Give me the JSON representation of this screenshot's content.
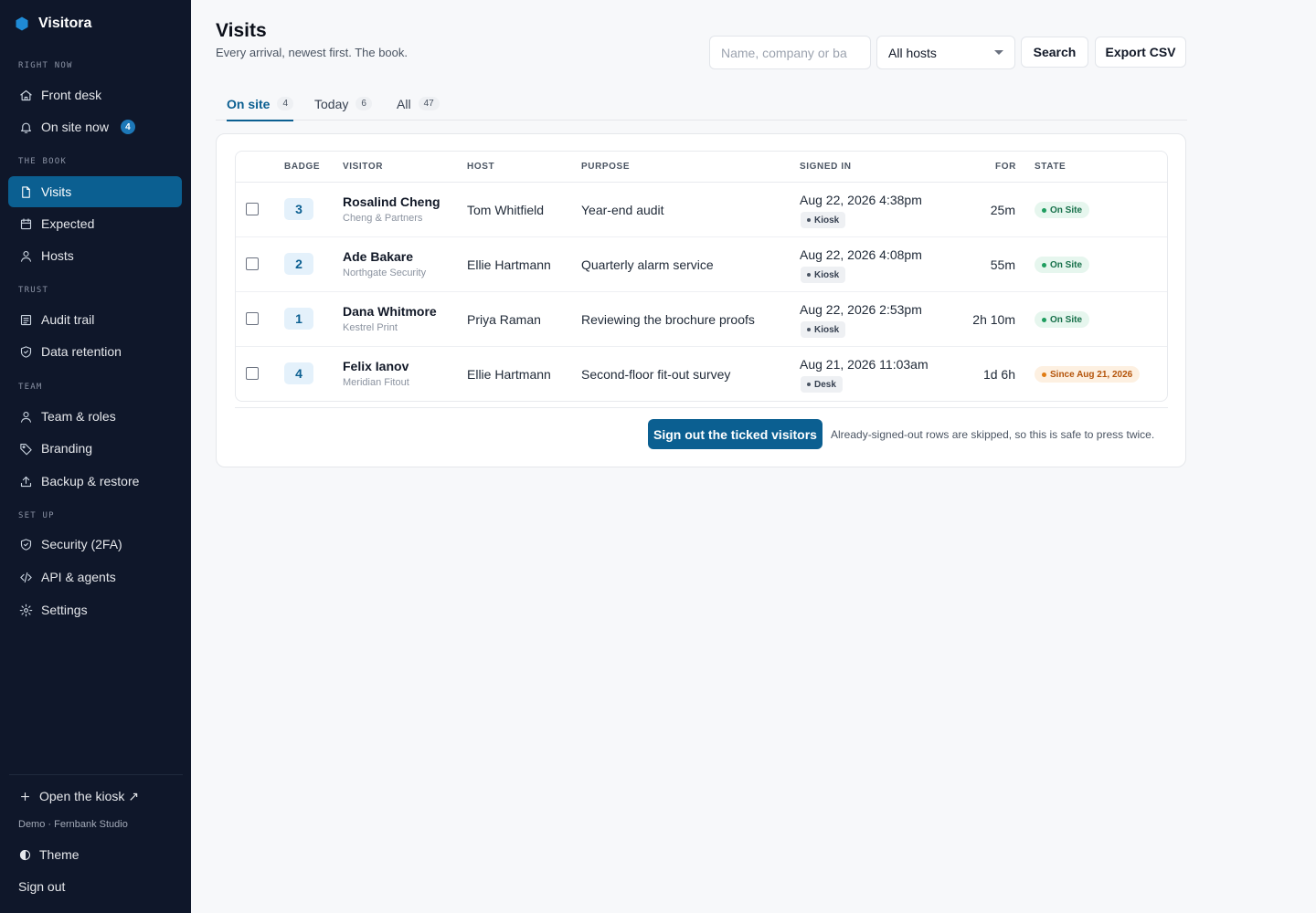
{
  "app": {
    "name": "Visitora"
  },
  "sidebar": {
    "sections": {
      "right_now": "RIGHT NOW",
      "the_book": "THE BOOK",
      "trust": "TRUST",
      "team": "TEAM",
      "set_up": "SET UP"
    },
    "items": {
      "front_desk": "Front desk",
      "on_site_now": "On site now",
      "on_site_count": "4",
      "visits": "Visits",
      "expected": "Expected",
      "hosts": "Hosts",
      "audit_trail": "Audit trail",
      "data_retention": "Data retention",
      "team_roles": "Team & roles",
      "branding": "Branding",
      "backup_restore": "Backup & restore",
      "security": "Security (2FA)",
      "api_agents": "API & agents",
      "settings": "Settings"
    },
    "footer": {
      "open_kiosk": "Open the kiosk ↗",
      "workspace": "Demo · Fernbank Studio",
      "theme": "Theme",
      "sign_out": "Sign out"
    }
  },
  "header": {
    "title": "Visits",
    "subtitle": "Every arrival, newest first. The book.",
    "search_placeholder": "Name, company or ba",
    "host_filter": "All hosts",
    "search_label": "Search",
    "export_label": "Export CSV"
  },
  "tabs": [
    {
      "label": "On site",
      "count": "4"
    },
    {
      "label": "Today",
      "count": "6"
    },
    {
      "label": "All",
      "count": "47"
    }
  ],
  "table": {
    "columns": {
      "badge": "BADGE",
      "visitor": "VISITOR",
      "host": "HOST",
      "purpose": "PURPOSE",
      "signed_in": "SIGNED IN",
      "for": "FOR",
      "state": "STATE"
    },
    "rows": [
      {
        "badge": "3",
        "name": "Rosalind Cheng",
        "company": "Cheng & Partners",
        "host": "Tom Whitfield",
        "purpose": "Year-end audit",
        "signed_in": "Aug 22, 2026 4:38pm",
        "source": "Kiosk",
        "duration": "25m",
        "state": "On Site"
      },
      {
        "badge": "2",
        "name": "Ade Bakare",
        "company": "Northgate Security",
        "host": "Ellie Hartmann",
        "purpose": "Quarterly alarm service",
        "signed_in": "Aug 22, 2026 4:08pm",
        "source": "Kiosk",
        "duration": "55m",
        "state": "On Site"
      },
      {
        "badge": "1",
        "name": "Dana Whitmore",
        "company": "Kestrel Print",
        "host": "Priya Raman",
        "purpose": "Reviewing the brochure proofs",
        "signed_in": "Aug 22, 2026 2:53pm",
        "source": "Kiosk",
        "duration": "2h 10m",
        "state": "On Site"
      },
      {
        "badge": "4",
        "name": "Felix Ianov",
        "company": "Meridian Fitout",
        "host": "Ellie Hartmann",
        "purpose": "Second-floor fit-out survey",
        "signed_in": "Aug 21, 2026 11:03am",
        "source": "Desk",
        "duration": "1d 6h",
        "state": "Since Aug 21, 2026"
      }
    ]
  },
  "actions": {
    "sign_out_ticked": "Sign out the ticked visitors",
    "hint": "Already-signed-out rows are skipped, so this is safe to press twice."
  },
  "colors": {
    "sidebar_bg": "#0f172a",
    "accent": "#0b5f91",
    "on_site": "#17704a",
    "since": "#b45309"
  }
}
